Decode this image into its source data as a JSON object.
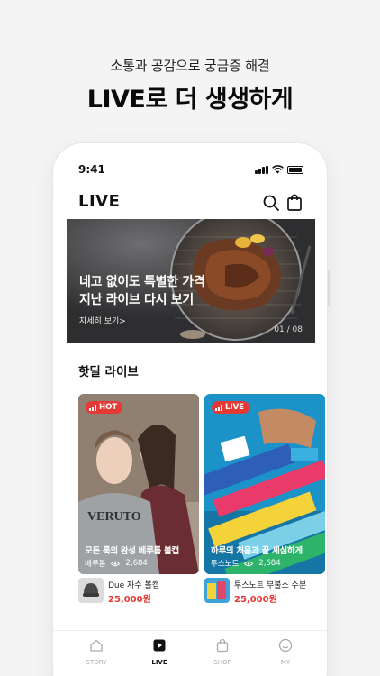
{
  "promo": {
    "subtitle": "소통과 공감으로 궁금증 해결",
    "title": "LIVE로 더 생생하게"
  },
  "status_bar": {
    "time": "9:41"
  },
  "header": {
    "title": "LIVE",
    "icons": [
      "search-icon",
      "shopping-bag-icon"
    ]
  },
  "banner": {
    "line1": "네고 없이도 특별한 가격",
    "line2": "지난 라이브 다시 보기",
    "link": "자세히 보기>",
    "page": "01 / 08"
  },
  "section": {
    "title": "핫딜 라이브"
  },
  "cards": [
    {
      "badge": "HOT",
      "badge_color": "#e53935",
      "caption": "모든 룩의 완성 베루톰 볼캡",
      "brand": "베루톰",
      "views": "2,684",
      "product_name": "Due 자수 볼캡",
      "price": "25,000원"
    },
    {
      "badge": "LIVE",
      "badge_color": "#e53935",
      "caption": "하루의 처음과 끝 세심하게",
      "brand": "투스노트",
      "views": "2,684",
      "product_name": "투스노트 무불소 수분",
      "price": "25,000원"
    }
  ],
  "bottom_nav": [
    {
      "label": "STORY",
      "icon": "home-icon",
      "active": false
    },
    {
      "label": "LIVE",
      "icon": "play-icon",
      "active": true
    },
    {
      "label": "SHOP",
      "icon": "shopping-bag-icon",
      "active": false
    },
    {
      "label": "MY",
      "icon": "smiley-icon",
      "active": false
    }
  ],
  "colors": {
    "accent": "#e53935",
    "background": "#f4f4f5"
  }
}
